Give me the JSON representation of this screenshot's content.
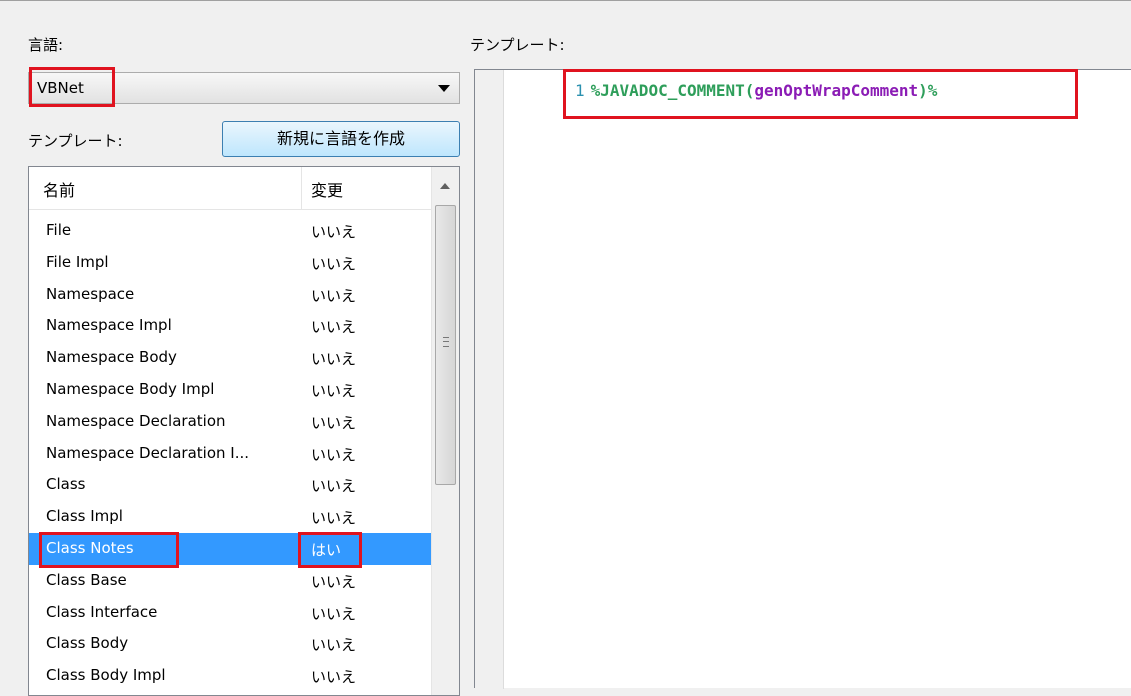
{
  "language": {
    "label": "言語:",
    "selected": "VBNet"
  },
  "templates": {
    "label": "テンプレート:",
    "new_language_button": "新規に言語を作成",
    "columns": {
      "name": "名前",
      "changed": "変更"
    },
    "rows": [
      {
        "name": "File",
        "changed": "いいえ"
      },
      {
        "name": "File Impl",
        "changed": "いいえ"
      },
      {
        "name": "Namespace",
        "changed": "いいえ"
      },
      {
        "name": "Namespace Impl",
        "changed": "いいえ"
      },
      {
        "name": "Namespace Body",
        "changed": "いいえ"
      },
      {
        "name": "Namespace Body Impl",
        "changed": "いいえ"
      },
      {
        "name": "Namespace Declaration",
        "changed": "いいえ"
      },
      {
        "name": "Namespace Declaration I...",
        "changed": "いいえ"
      },
      {
        "name": "Class",
        "changed": "いいえ"
      },
      {
        "name": "Class Impl",
        "changed": "いいえ"
      },
      {
        "name": "Class Notes",
        "changed": "はい",
        "selected": true
      },
      {
        "name": "Class Base",
        "changed": "いいえ"
      },
      {
        "name": "Class Interface",
        "changed": "いいえ"
      },
      {
        "name": "Class Body",
        "changed": "いいえ"
      },
      {
        "name": "Class Body Impl",
        "changed": "いいえ"
      }
    ]
  },
  "editor": {
    "label": "テンプレート:",
    "line_number": "1",
    "code": {
      "macro_open": "%JAVADOC_COMMENT(",
      "argument": "genOptWrapComment",
      "macro_close": ")%"
    }
  },
  "colors": {
    "highlight_box": "#e0131f",
    "selection": "#3399ff",
    "macro": "#2e9e5a",
    "argument": "#8b1cb5"
  }
}
